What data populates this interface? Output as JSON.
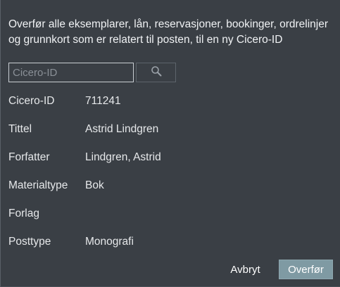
{
  "dialog": {
    "description": "Overfør alle eksemplarer, lån, reservasjoner, bookinger, ordrelinjer og grunnkort som er relatert til posten, til en ny Cicero-ID"
  },
  "search": {
    "placeholder": "Cicero-ID",
    "value": "",
    "icon": "search-icon"
  },
  "fields": [
    {
      "label": "Cicero-ID",
      "value": "711241"
    },
    {
      "label": "Tittel",
      "value": "Astrid Lindgren"
    },
    {
      "label": "Forfatter",
      "value": "Lindgren, Astrid"
    },
    {
      "label": "Materialtype",
      "value": "Bok"
    },
    {
      "label": "Forlag",
      "value": ""
    },
    {
      "label": "Posttype",
      "value": "Monografi"
    }
  ],
  "actions": {
    "cancel_label": "Avbryt",
    "transfer_label": "Overfør"
  },
  "colors": {
    "background": "#3a3f45",
    "primary_button": "#7f9aa3",
    "text": "#e6e8ea"
  }
}
